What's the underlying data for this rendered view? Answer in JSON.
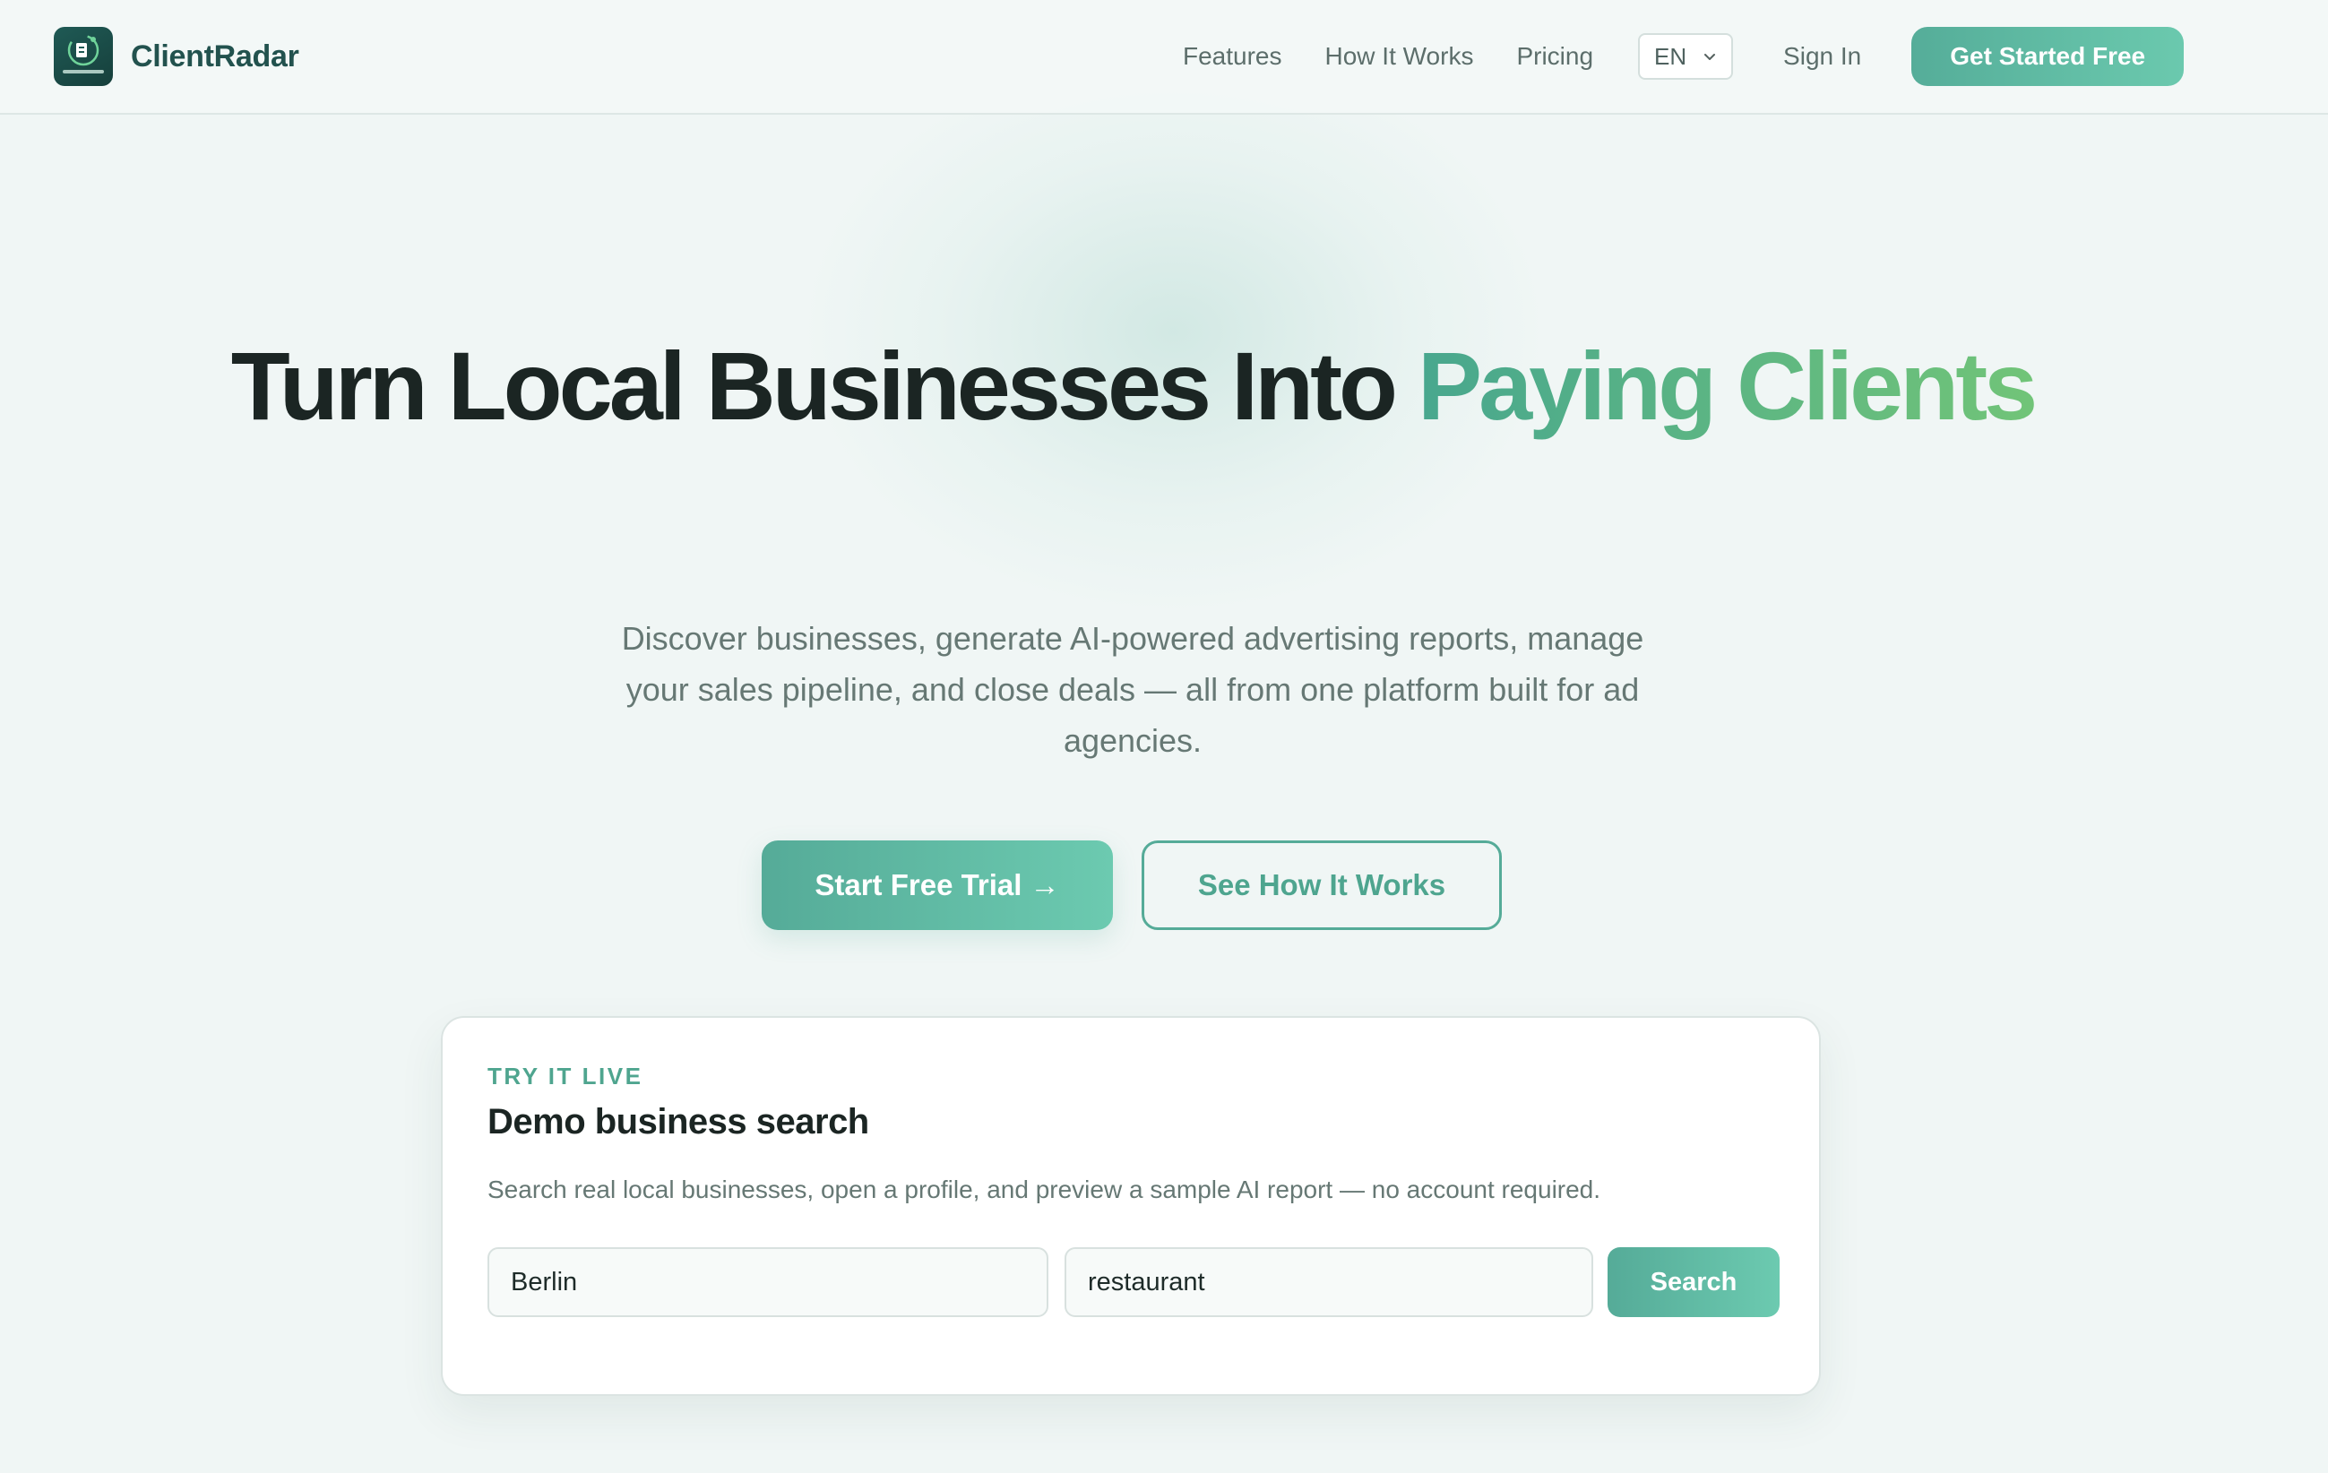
{
  "header": {
    "brand": "ClientRadar",
    "nav": {
      "features": "Features",
      "how_it_works": "How It Works",
      "pricing": "Pricing"
    },
    "language": "EN",
    "sign_in": "Sign In",
    "get_started": "Get Started Free"
  },
  "hero": {
    "title_part1": "Turn Local Businesses Into ",
    "title_accent": "Paying Clients",
    "subtitle": "Discover businesses, generate AI-powered advertising reports, manage your sales pipeline, and close deals — all from one platform built for ad agencies.",
    "primary_cta": "Start Free Trial →",
    "secondary_cta": "See How It Works"
  },
  "demo": {
    "eyebrow": "TRY IT LIVE",
    "title": "Demo business search",
    "description": "Search real local businesses, open a profile, and preview a sample AI report — no account required.",
    "city_value": "Berlin",
    "category_value": "restaurant",
    "search_label": "Search"
  },
  "colors": {
    "accent_start": "#55ab98",
    "accent_end": "#6ccab0",
    "heading": "#1b2523",
    "brand_text": "#22524e",
    "background": "#f0f6f5"
  },
  "icons": {
    "logo": "radar-logo-icon",
    "language_chevron": "chevron-down-icon",
    "cta_arrow": "arrow-right"
  }
}
